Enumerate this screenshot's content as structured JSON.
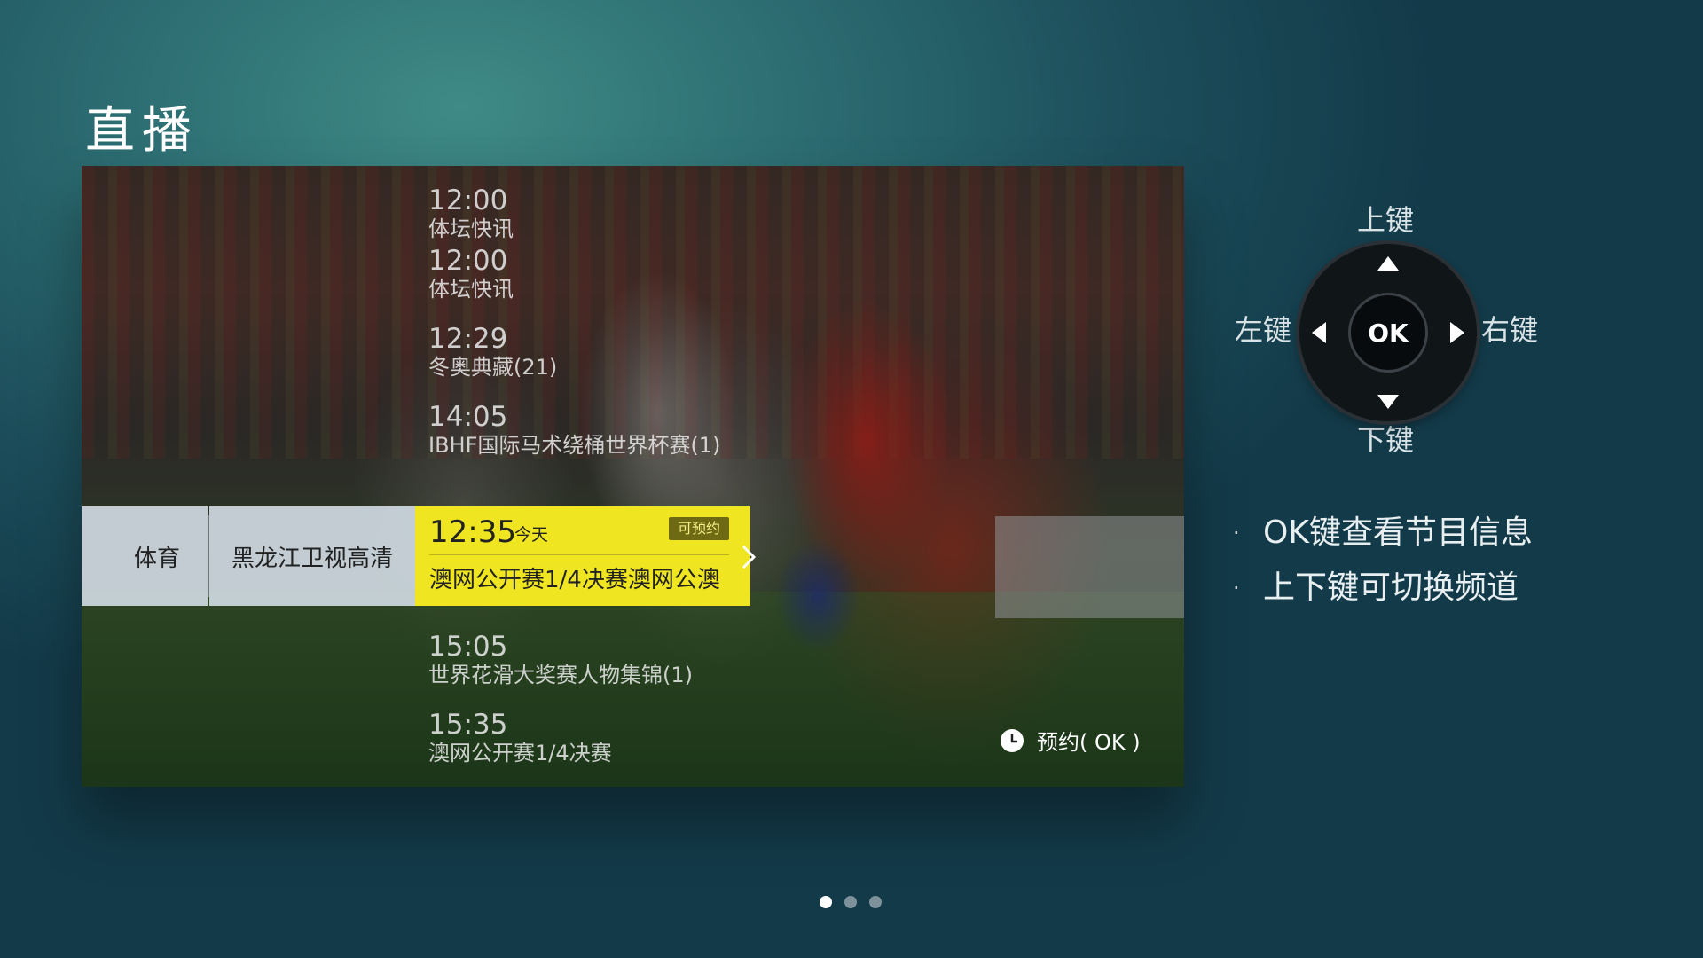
{
  "page": {
    "title": "直播"
  },
  "program_list_upper": [
    {
      "time": "12:00",
      "name": "体坛快讯"
    },
    {
      "time": "12:00",
      "name": "体坛快讯"
    },
    {
      "time": "12:29",
      "name": "冬奥典藏(21)"
    },
    {
      "time": "14:05",
      "name": "IBHF国际马术绕桶世界杯赛(1)"
    }
  ],
  "channel_bar": {
    "category": "体育",
    "channel": "黑龙江卫视高清",
    "current": {
      "time": "12:35",
      "day": "今天",
      "badge": "可预约",
      "name": "澳网公开赛1/4决赛澳网公澳"
    }
  },
  "program_list_lower": [
    {
      "time": "15:05",
      "name": "世界花滑大奖赛人物集锦(1)"
    },
    {
      "time": "15:35",
      "name": "澳网公开赛1/4决赛"
    }
  ],
  "reserve": {
    "icon": "clock-icon",
    "label": "预约( OK )"
  },
  "remote": {
    "up_label": "上键",
    "down_label": "下键",
    "left_label": "左键",
    "right_label": "右键",
    "ok_label": "OK"
  },
  "hints": [
    "OK键查看节目信息",
    "上下键可切换频道"
  ],
  "pagination": {
    "total": 3,
    "active": 1
  },
  "colors": {
    "highlight": "#efe521",
    "badge": "#6e6a13",
    "background": "#1c4d5a"
  }
}
